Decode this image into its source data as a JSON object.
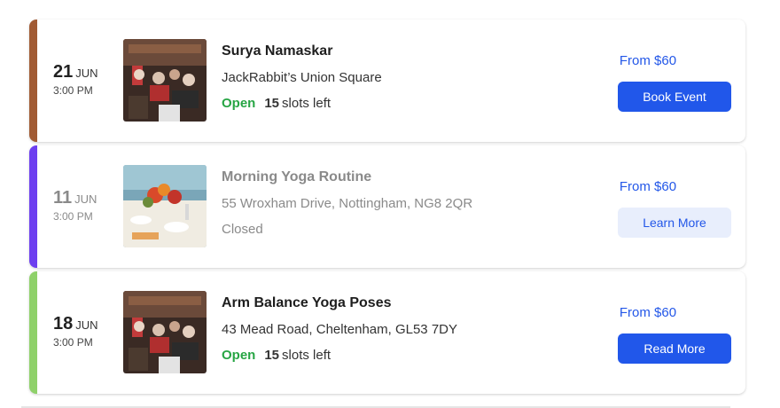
{
  "events": [
    {
      "day": "21",
      "month": "JUN",
      "time": "3:00 PM",
      "title": "Surya Namaskar",
      "location": "JackRabbit’s Union Square",
      "status": "Open",
      "slots": "15",
      "slots_label": "slots left",
      "price": "From $60",
      "button": "Book Event",
      "accent": "#a15b34",
      "image": "crowd-photo"
    },
    {
      "day": "11",
      "month": "JUN",
      "time": "3:00 PM",
      "title": "Morning Yoga Routine",
      "location": "55 Wroxham Drive, Nottingham, NG8 2QR",
      "status": "Closed",
      "price": "From $60",
      "button": "Learn More",
      "accent": "#6d3ff0",
      "image": "dinner-table-photo"
    },
    {
      "day": "18",
      "month": "JUN",
      "time": "3:00 PM",
      "title": "Arm Balance Yoga Poses",
      "location": "43 Mead Road, Cheltenham, GL53 7DY",
      "status": "Open",
      "slots": "15",
      "slots_label": "slots left",
      "price": "From $60",
      "button": "Read More",
      "accent": "#8fd16a",
      "image": "crowd-photo"
    }
  ]
}
